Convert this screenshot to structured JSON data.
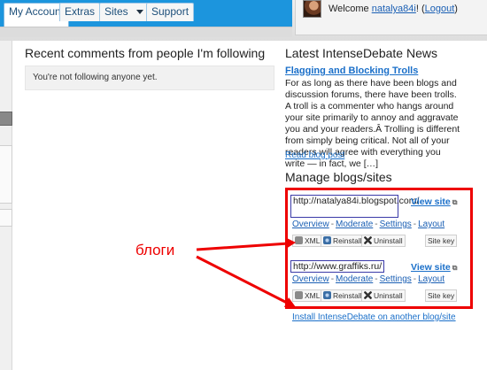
{
  "header": {
    "tabs": [
      {
        "label": "My Account",
        "active": true
      },
      {
        "label": "Extras",
        "active": false
      },
      {
        "label": "Sites",
        "active": false
      },
      {
        "label": "Support",
        "active": false
      }
    ],
    "welcome_prefix": "Welcome ",
    "username": "natalya84i",
    "welcome_separator": "! (",
    "logout_label": "Logout",
    "welcome_suffix": ")"
  },
  "recent_comments": {
    "title": "Recent comments from people I'm following",
    "empty_text": "You're not following anyone yet."
  },
  "news": {
    "title": "Latest IntenseDebate News",
    "post_title": "Flagging and Blocking Trolls",
    "post_body": "For as long as there have been blogs and discussion forums, there have been trolls. A troll is a commenter who hangs around your site primarily to annoy and aggravate you and your readers.Â Trolling is different from simply being critical. Not all of your readers will agree with everything you write — in fact, we […]",
    "read_more": "Read blog post"
  },
  "manage": {
    "title": "Manage blogs/sites",
    "sites": [
      {
        "url": "http://natalya84i.blogspot.com/",
        "view_label": "View site"
      },
      {
        "url": "http://www.graffiks.ru/",
        "view_label": "View site"
      }
    ],
    "links": [
      "Overview",
      "Moderate",
      "Settings",
      "Layout"
    ],
    "buttons": {
      "xml": "XML",
      "reinstall": "Reinstall",
      "uninstall": "Uninstall",
      "site_key": "Site key"
    },
    "install_another": "Install IntenseDebate on another blog/site"
  },
  "annotation": {
    "label": "блоги",
    "color": "#ee0000"
  },
  "colors": {
    "tab_bar": "#1c95dd",
    "link": "#1a6fc9"
  }
}
